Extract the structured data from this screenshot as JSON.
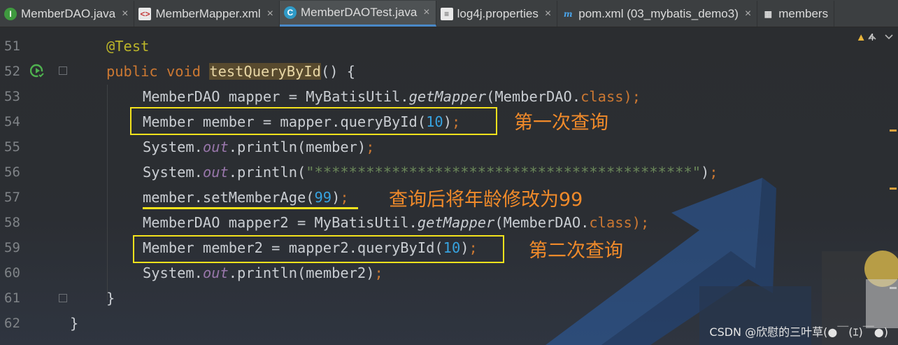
{
  "tabs": [
    {
      "label": "MemberDAO.java",
      "icon": "interface-icon",
      "glyph": "I",
      "active": false
    },
    {
      "label": "MemberMapper.xml",
      "icon": "xml-file-icon",
      "glyph": "<>",
      "active": false
    },
    {
      "label": "MemberDAOTest.java",
      "icon": "test-class-icon",
      "glyph": "C",
      "active": true
    },
    {
      "label": "log4j.properties",
      "icon": "properties-file-icon",
      "glyph": "≡",
      "active": false
    },
    {
      "label": "pom.xml (03_mybatis_demo3)",
      "icon": "maven-icon",
      "glyph": "m",
      "active": false
    },
    {
      "label": "members",
      "icon": "table-icon",
      "glyph": "▦",
      "active": false
    }
  ],
  "tab_close_glyph": "×",
  "inspection": {
    "warning_count": "4"
  },
  "line_numbers": [
    "51",
    "52",
    "53",
    "54",
    "55",
    "56",
    "57",
    "58",
    "59",
    "60",
    "61",
    "62"
  ],
  "code": {
    "l51": {
      "annotation": "@Test"
    },
    "l52": {
      "kw1": "public",
      "kw2": "void",
      "method": "testQueryById",
      "rest": "() {"
    },
    "l53": {
      "a": "MemberDAO mapper = MyBatisUtil.",
      "b": "getMapper",
      "c": "(MemberDAO.",
      "d": "class",
      "e": ");"
    },
    "l54": {
      "a": "Member member = mapper.queryById(",
      "num": "10",
      "b": ")",
      "semi": ";"
    },
    "l55": {
      "a": "System.",
      "field": "out",
      "b": ".println(member)",
      "semi": ";"
    },
    "l56": {
      "a": "System.",
      "field": "out",
      "b": ".println(",
      "str": "\"********************************************\"",
      "c": ")",
      "semi": ";"
    },
    "l57": {
      "a": "member.setMemberAge(",
      "num": "99",
      "b": ")",
      "semi": ";"
    },
    "l58": {
      "a": "MemberDAO mapper2 = MyBatisUtil.",
      "b": "getMapper",
      "c": "(MemberDAO.",
      "d": "class",
      "e": ");"
    },
    "l59": {
      "a": "Member member2 = mapper2.queryById(",
      "num": "10",
      "b": ")",
      "semi": ";"
    },
    "l60": {
      "a": "System.",
      "field": "out",
      "b": ".println(member2)",
      "semi": ";"
    },
    "l61": {
      "a": "}"
    },
    "l62": {
      "a": "}"
    }
  },
  "annotations": {
    "first_query": "第一次查询",
    "modify_age": "查询后将年龄修改为99",
    "second_query": "第二次查询"
  },
  "watermark": "CSDN @欣慰的三叶草(●￣(ｴ)￣●)",
  "colors": {
    "highlight_box": "#f3e21c",
    "annotation_text": "#f08a2a",
    "keyword": "#cc7832",
    "number": "#37a3e0",
    "string": "#6a8759"
  }
}
